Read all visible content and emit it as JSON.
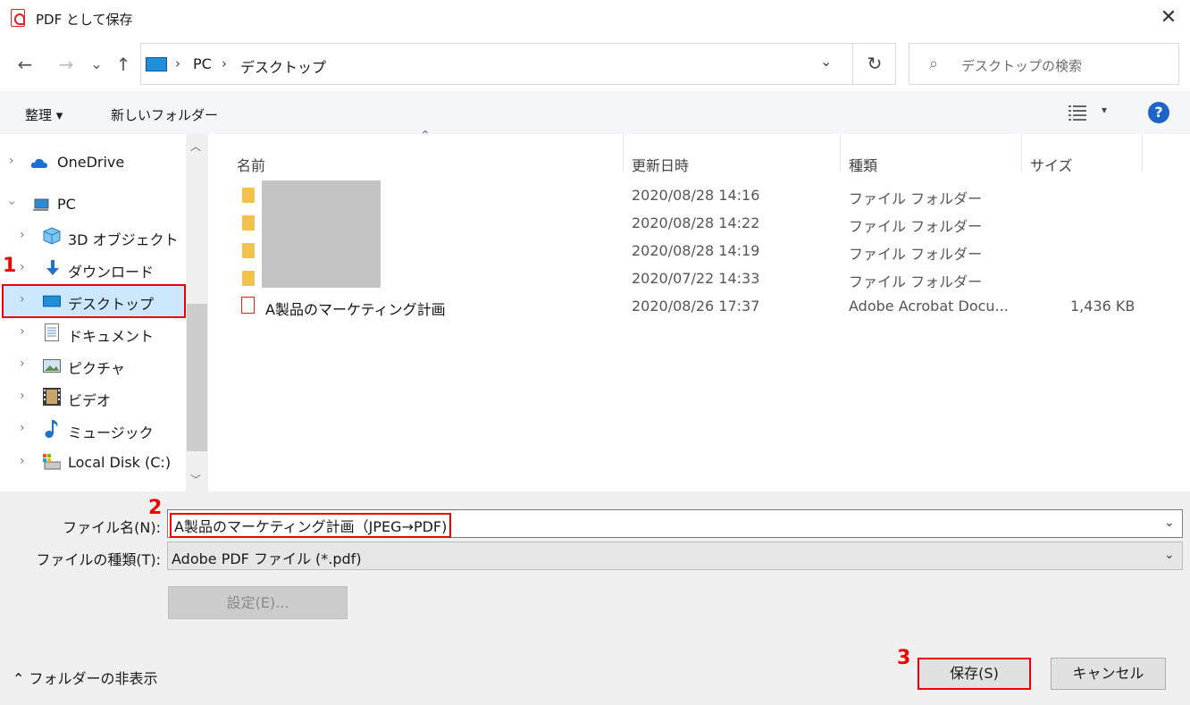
{
  "window": {
    "title": "PDF として保存",
    "close_glyph": "✕"
  },
  "nav": {
    "back": "←",
    "forward": "→",
    "recent": "⌄",
    "up": "↑"
  },
  "address": {
    "crumbs": [
      "PC",
      "デスクトップ"
    ],
    "separator": "›",
    "dropdown": "⌄",
    "refresh": "↻"
  },
  "search": {
    "placeholder": "デスクトップの検索",
    "icon": "⌕"
  },
  "toolbar": {
    "organize": "整理 ▾",
    "new_folder": "新しいフォルダー",
    "view_dd": "▾",
    "help": "?"
  },
  "sidebar": {
    "items": [
      {
        "label": "OneDrive",
        "icon": "cloud-icon"
      },
      {
        "label": "PC",
        "icon": "pc-icon"
      },
      {
        "label": "3D オブジェクト",
        "icon": "3d-objects-icon"
      },
      {
        "label": "ダウンロード",
        "icon": "download-icon"
      },
      {
        "label": "デスクトップ",
        "icon": "desktop-icon",
        "selected": true
      },
      {
        "label": "ドキュメント",
        "icon": "document-icon"
      },
      {
        "label": "ピクチャ",
        "icon": "picture-icon"
      },
      {
        "label": "ビデオ",
        "icon": "video-icon"
      },
      {
        "label": "ミュージック",
        "icon": "music-icon"
      },
      {
        "label": "Local Disk (C:)",
        "icon": "disk-icon"
      }
    ]
  },
  "list": {
    "columns": [
      "名前",
      "更新日時",
      "種類",
      "サイズ"
    ],
    "sort_indicator": "⌃",
    "rows": [
      {
        "name": "",
        "date": "2020/08/28 14:16",
        "type": "ファイル フォルダー",
        "size": ""
      },
      {
        "name": "",
        "date": "2020/08/28 14:22",
        "type": "ファイル フォルダー",
        "size": ""
      },
      {
        "name": "",
        "date": "2020/08/28 14:19",
        "type": "ファイル フォルダー",
        "size": ""
      },
      {
        "name": "",
        "date": "2020/07/22 14:33",
        "type": "ファイル フォルダー",
        "size": ""
      },
      {
        "name": "A製品のマーケティング計画",
        "date": "2020/08/26 17:37",
        "type": "Adobe Acrobat Docu...",
        "size": "1,436 KB"
      }
    ]
  },
  "form": {
    "filename_label": "ファイル名(N):",
    "filename_value": "A製品のマーケティング計画（JPEG→PDF)",
    "filetype_label": "ファイルの種類(T):",
    "filetype_value": "Adobe PDF ファイル (*.pdf)",
    "settings_button": "設定(E)...",
    "dropdown": "⌄"
  },
  "footer": {
    "hide_folders": "⌃ フォルダーの非表示",
    "save": "保存(S)",
    "cancel": "キャンセル"
  },
  "annotations": [
    "1",
    "2",
    "3"
  ],
  "colors": {
    "annotation": "#e00000",
    "selection": "#cce8ff",
    "accent": "#1e64c8"
  }
}
